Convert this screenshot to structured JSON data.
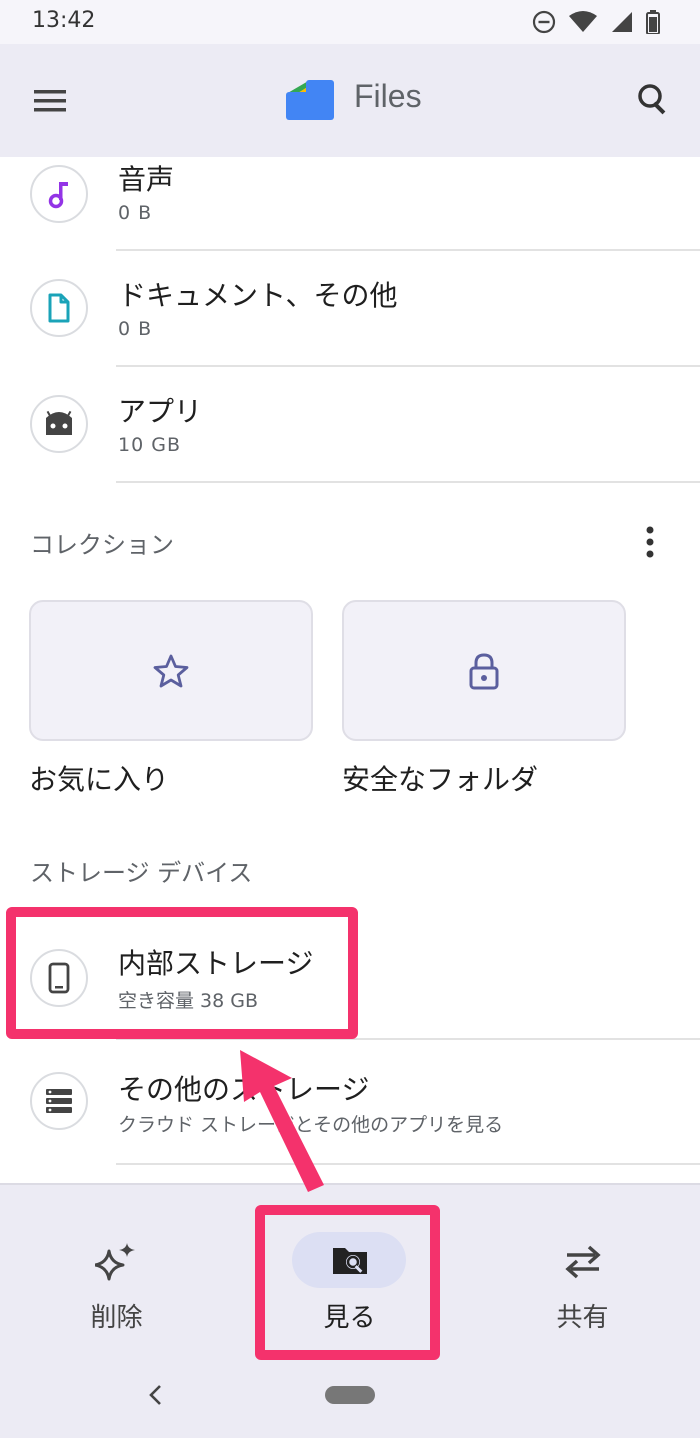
{
  "status": {
    "time": "13:42"
  },
  "app": {
    "title": "Files"
  },
  "categories": [
    {
      "title": "音声",
      "subtitle": "0 B",
      "icon": "music-note-icon"
    },
    {
      "title": "ドキュメント、その他",
      "subtitle": "0 B",
      "icon": "document-icon"
    },
    {
      "title": "アプリ",
      "subtitle": "10 GB",
      "icon": "android-icon"
    }
  ],
  "collections": {
    "title": "コレクション",
    "items": [
      {
        "label": "お気に入り",
        "icon": "star-icon"
      },
      {
        "label": "安全なフォルダ",
        "icon": "lock-icon"
      }
    ]
  },
  "storage": {
    "title": "ストレージ デバイス",
    "items": [
      {
        "title": "内部ストレージ",
        "subtitle": "空き容量 38 GB",
        "icon": "phone-icon"
      },
      {
        "title": "その他のストレージ",
        "subtitle": "クラウド ストレージとその他のアプリを見る",
        "icon": "storage-list-icon"
      }
    ]
  },
  "bottomnav": [
    {
      "label": "削除",
      "icon": "sparkle-icon"
    },
    {
      "label": "見る",
      "icon": "folder-search-icon",
      "active": true
    },
    {
      "label": "共有",
      "icon": "swap-arrows-icon"
    }
  ],
  "colors": {
    "accent": "#f4326c",
    "appbar": "#ecebf4",
    "icon_tint": "#5b5f9e"
  }
}
